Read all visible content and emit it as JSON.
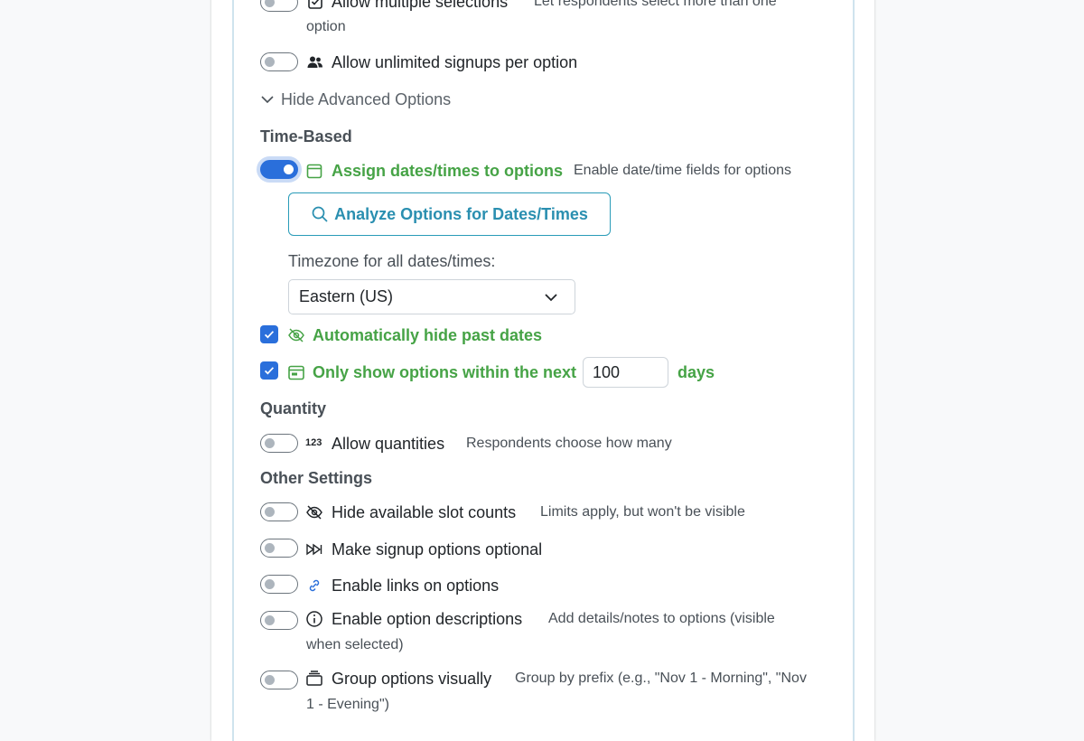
{
  "settings": {
    "multiple_selections": {
      "label": "Allow multiple selections",
      "desc_line1": "Let respondents select more than one",
      "desc_line2": "option",
      "enabled": false,
      "icon": "checkbox-icon"
    },
    "unlimited_signups": {
      "label": "Allow unlimited signups per option",
      "enabled": false,
      "icon": "people-icon"
    },
    "advanced_toggle_label": "Hide Advanced Options"
  },
  "time_based": {
    "heading": "Time-Based",
    "assign_dates": {
      "label": "Assign dates/times to options",
      "desc": "Enable date/time fields for options",
      "enabled": true,
      "icon": "calendar-icon"
    },
    "analyze_button": "Analyze Options for Dates/Times",
    "timezone_label": "Timezone for all dates/times:",
    "timezone_value": "Eastern (US)",
    "hide_past": {
      "label": "Automatically hide past dates",
      "checked": true,
      "icon": "eye-slash-icon"
    },
    "within_next": {
      "label": "Only show options within the next",
      "value": "100",
      "unit": "days",
      "checked": true,
      "icon": "calendar-range-icon"
    }
  },
  "quantity": {
    "heading": "Quantity",
    "icon_text": "123",
    "label": "Allow quantities",
    "desc": "Respondents choose how many",
    "enabled": false
  },
  "other": {
    "heading": "Other Settings",
    "hide_counts": {
      "label": "Hide available slot counts",
      "desc": "Limits apply, but won't be visible",
      "enabled": false
    },
    "optional": {
      "label": "Make signup options optional",
      "enabled": false
    },
    "links": {
      "label": "Enable links on options",
      "enabled": false
    },
    "descriptions": {
      "label": "Enable option descriptions",
      "desc_line1": "Add details/notes to options (visible",
      "desc_line2": "when selected)",
      "enabled": false
    },
    "group": {
      "label": "Group options visually",
      "desc_line1": "Group by prefix (e.g., \"Nov 1 - Morning\", \"Nov",
      "desc_line2": "1 - Evening\")",
      "enabled": false
    }
  },
  "colors": {
    "accent_blue": "#2a6fdb",
    "active_green": "#46a346",
    "button_teal": "#2a8fb0"
  }
}
